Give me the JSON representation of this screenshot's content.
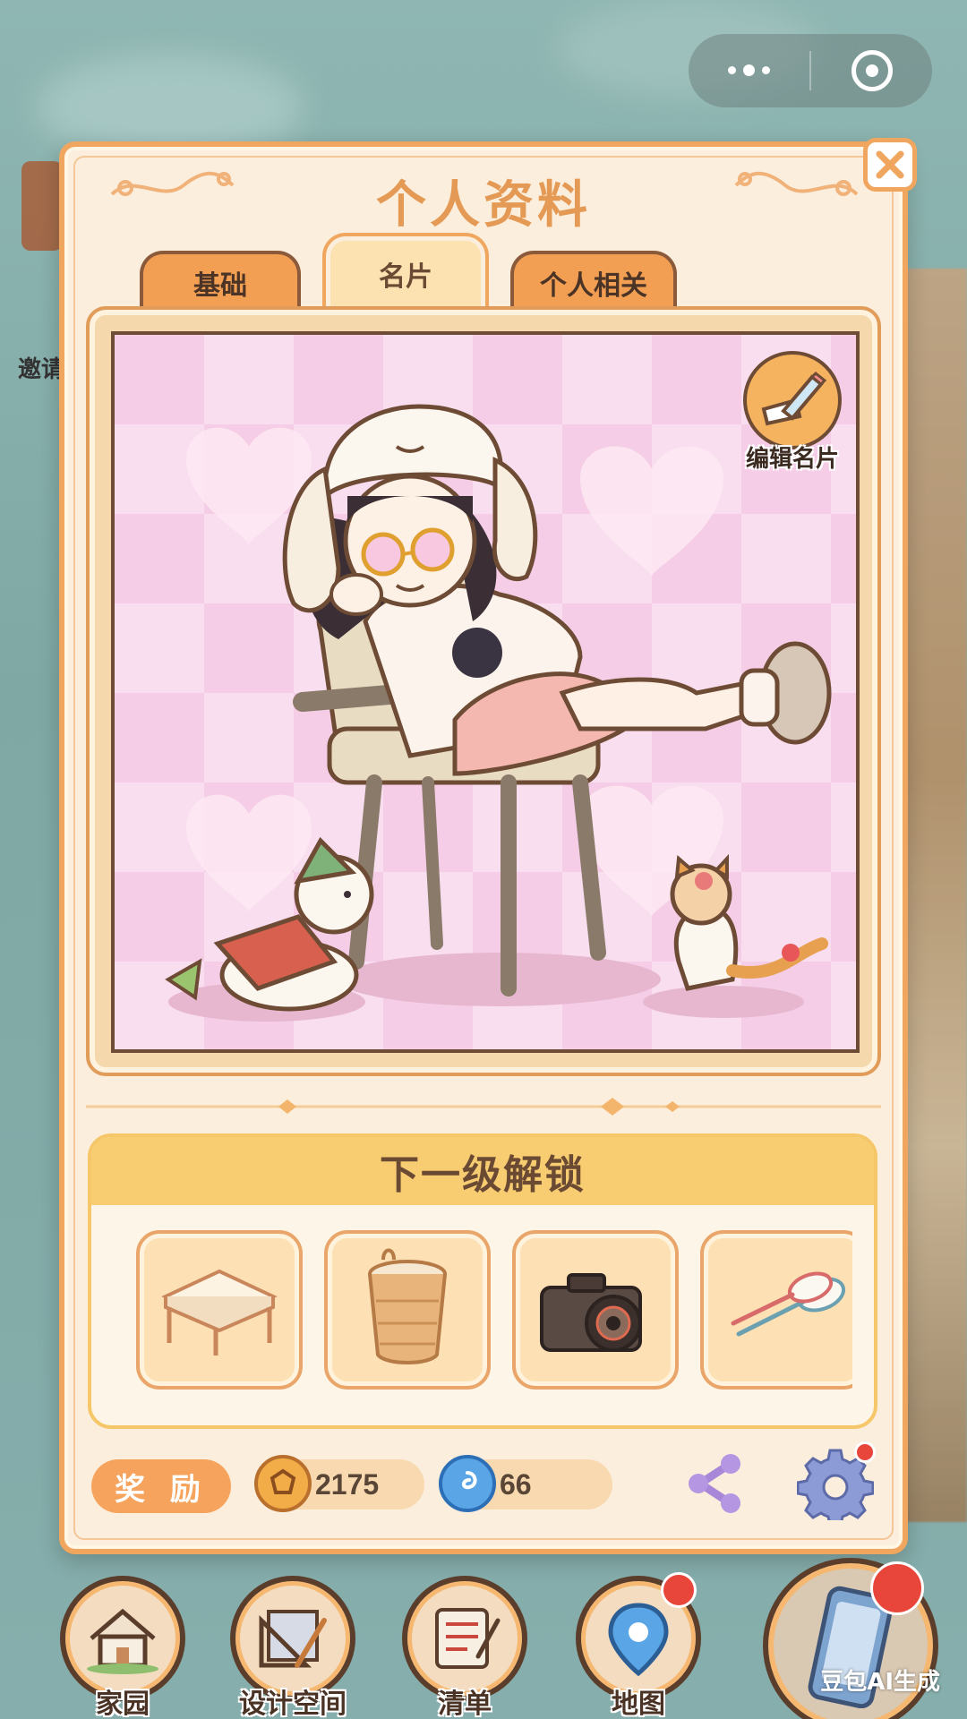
{
  "background": {
    "invite_hint": "邀请"
  },
  "capsule": {
    "more_icon": "more-dots-icon",
    "close_icon": "target-circle-icon"
  },
  "dialog": {
    "title": "个人资料",
    "close_icon": "close-x-icon",
    "tabs": [
      {
        "label": "基础",
        "active": false
      },
      {
        "label": "名片",
        "active": true
      },
      {
        "label": "个人相关",
        "active": false
      }
    ],
    "card": {
      "edit_label": "编辑名片",
      "edit_icon": "pencil-paper-icon"
    },
    "unlock": {
      "header": "下一级解锁",
      "items": [
        {
          "icon": "table-icon"
        },
        {
          "icon": "basket-icon"
        },
        {
          "icon": "camera-icon"
        },
        {
          "icon": "badminton-racket-icon"
        }
      ]
    },
    "footer": {
      "reward_label": "奖 励",
      "coins": "2175",
      "gems": "66",
      "share_icon": "share-icon",
      "settings_icon": "gear-icon"
    }
  },
  "bottom_nav": [
    {
      "label": "家园",
      "icon": "house-icon"
    },
    {
      "label": "设计空间",
      "icon": "ruler-icon"
    },
    {
      "label": "清单",
      "icon": "checklist-icon"
    },
    {
      "label": "地图",
      "icon": "map-pin-icon"
    },
    {
      "label": "手机",
      "icon": "phone-icon"
    }
  ],
  "watermark": "豆包AI生成",
  "colors": {
    "accent": "#f0a65e",
    "panel": "#fbeedd",
    "title": "#e49a55",
    "badge": "#e8463a"
  }
}
